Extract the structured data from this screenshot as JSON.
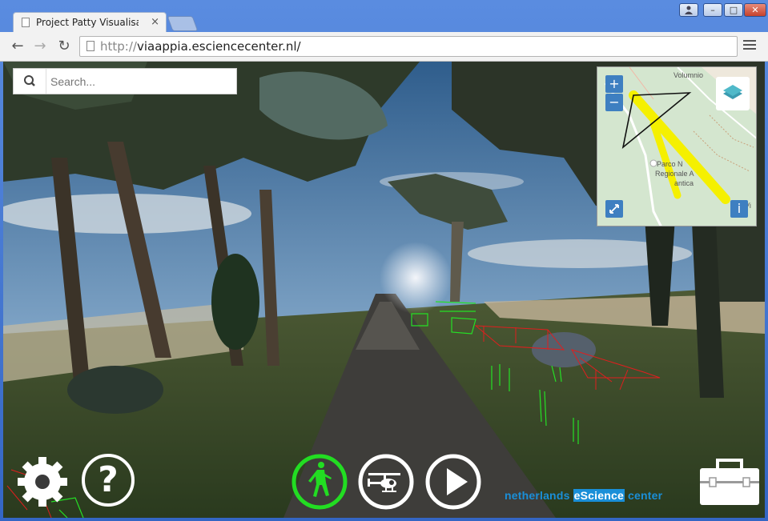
{
  "browser": {
    "tab_title": "Project Patty Visualisat",
    "tab_close": "×",
    "url_scheme": "http://",
    "url_host": "viaappia.esciencecenter.nl",
    "url_cursor": "/",
    "window_buttons": {
      "user": "👤",
      "minimize": "–",
      "maximize": "□",
      "close": "✕"
    },
    "nav": {
      "back": "←",
      "forward": "→",
      "reload": "↻"
    }
  },
  "search": {
    "placeholder": "Search..."
  },
  "minimap": {
    "zoom_in": "+",
    "zoom_out": "−",
    "info": "i",
    "labels": [
      "Volumnio",
      "Parco N",
      "Regionale A",
      "antica",
      "Vi"
    ]
  },
  "controls": {
    "settings": "gear-icon",
    "help": "?",
    "walk_mode": "pedestrian-icon",
    "fly_mode": "helicopter-icon",
    "play": "play-icon",
    "toolbox": "toolbox-icon"
  },
  "brand": {
    "part1": "netherlands ",
    "part2": "eScience",
    "part3": " center"
  },
  "colors": {
    "accent_green": "#22dd22",
    "brand_blue": "#1a8fd8",
    "map_button": "#3e7fc1",
    "path_yellow": "#f5f000"
  }
}
